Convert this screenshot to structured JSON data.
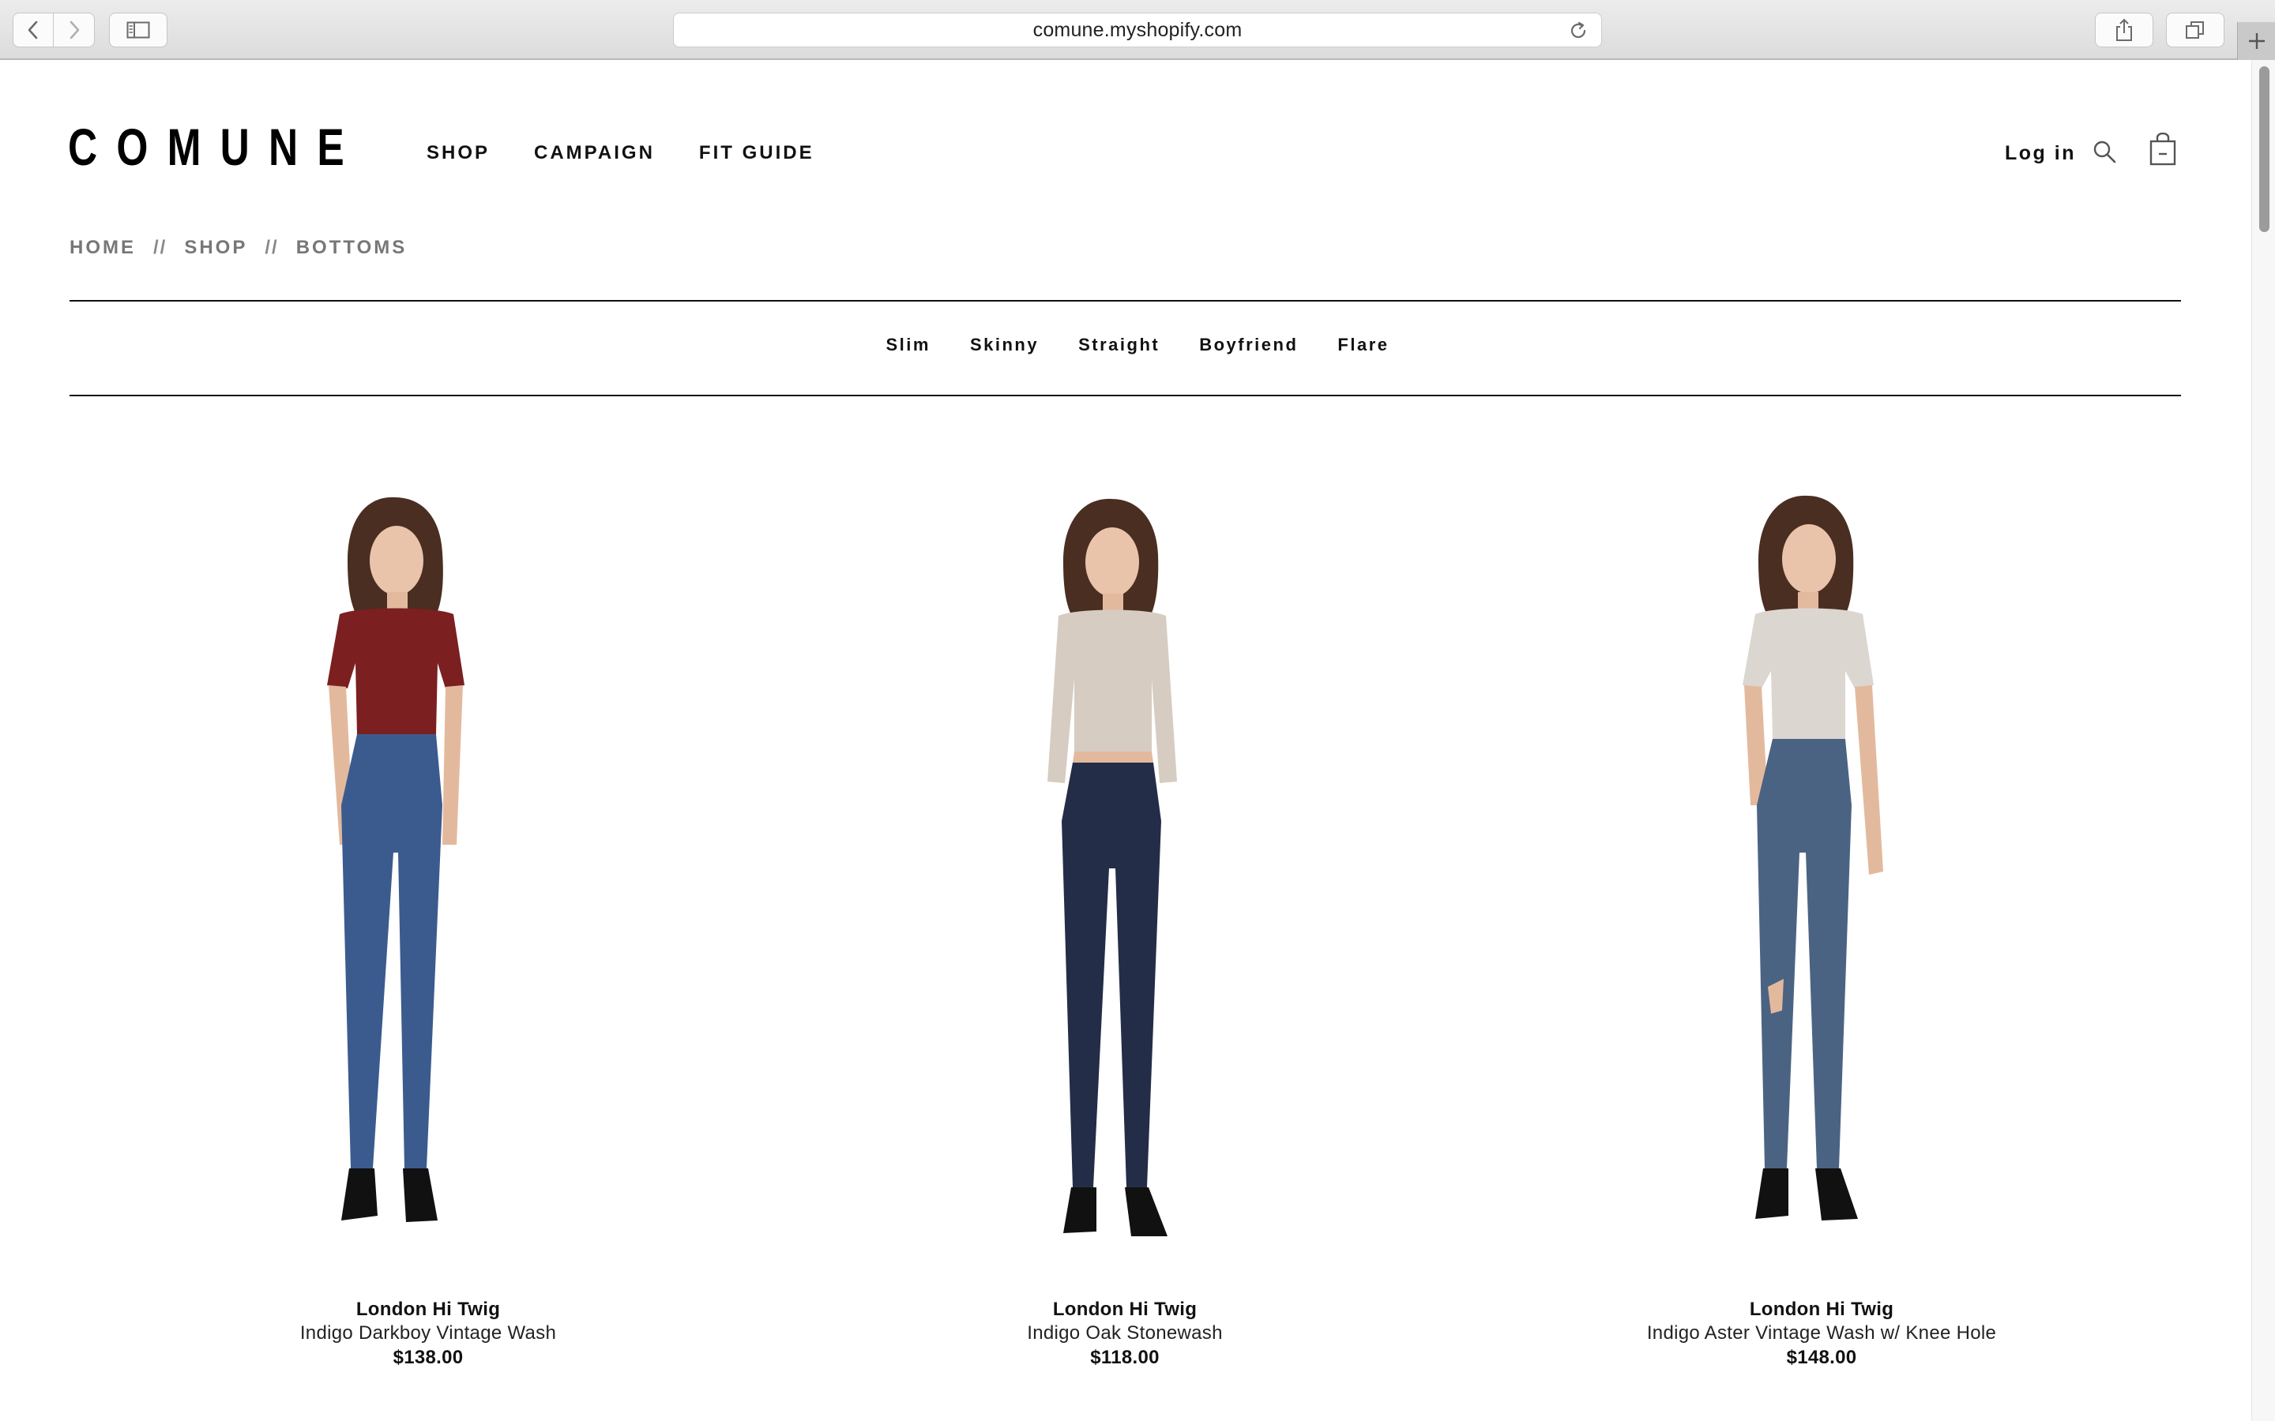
{
  "browser": {
    "url": "comune.myshopify.com"
  },
  "site": {
    "logo": "COMUNE",
    "nav": [
      "SHOP",
      "CAMPAIGN",
      "FIT GUIDE"
    ],
    "login": "Log in",
    "search_icon": "search-icon",
    "cart_icon": "shopping-bag-icon"
  },
  "breadcrumb": {
    "items": [
      "HOME",
      "SHOP",
      "BOTTOMS"
    ],
    "separator": "//"
  },
  "filters": [
    "Slim",
    "Skinny",
    "Straight",
    "Boyfriend",
    "Flare"
  ],
  "products": [
    {
      "name": "London Hi Twig",
      "variant": "Indigo Darkboy Vintage Wash",
      "price": "$138.00",
      "top_color": "#7b1f21",
      "denim_color": "#3b5b8e"
    },
    {
      "name": "London Hi Twig",
      "variant": "Indigo Oak Stonewash",
      "price": "$118.00",
      "top_color": "#d6ccc2",
      "denim_color": "#242d47"
    },
    {
      "name": "London Hi Twig",
      "variant": "Indigo Aster Vintage Wash w/ Knee Hole",
      "price": "$148.00",
      "top_color": "#dcd6d0",
      "denim_color": "#4b6383"
    }
  ]
}
